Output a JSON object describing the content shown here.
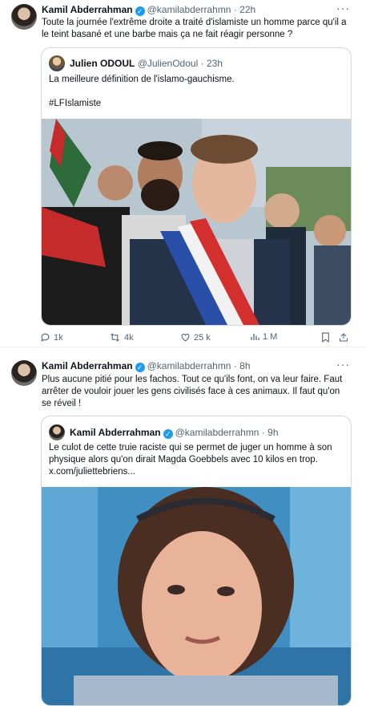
{
  "tweets": [
    {
      "author": "Kamil Abderrahman",
      "handle": "@kamilabderrahmn",
      "time": "· 22h",
      "text": "Toute la journée l'extrême droite a traité d'islamiste un homme parce qu'il a le teint basané et une barbe mais ça ne fait réagir personne ?",
      "quote": {
        "author": "Julien ODOUL",
        "handle": "@JulienOdoul",
        "time": "· 23h",
        "text": "La meilleure définition de l'islamo-gauchisme.\n\n#LFIslamiste"
      },
      "stats": {
        "replies": "1k",
        "retweets": "4k",
        "likes": "25 k",
        "views": "1 M"
      }
    },
    {
      "author": "Kamil Abderrahman",
      "handle": "@kamilabderrahmn",
      "time": "· 8h",
      "text": "Plus aucune pitié pour les fachos. Tout ce qu'ils font, on va leur faire. Faut arrêter de vouloir jouer les gens civilisés face à ces animaux. Il faut qu'on se réveil !",
      "quote": {
        "author": "Kamil Abderrahman",
        "handle": "@kamilabderrahmn",
        "time": "· 9h",
        "text": "Le culot de cette truie raciste qui se permet de juger un homme à son physique alors qu'on dirait Magda Goebbels avec 10 kilos en trop. x.com/juliettebriens..."
      }
    }
  ],
  "colors": {
    "accent": "#1d9bf0",
    "muted": "#536471",
    "border": "#cfd9de"
  },
  "icons": [
    "reply-icon",
    "retweet-icon",
    "like-icon",
    "views-icon",
    "bookmark-icon",
    "share-icon",
    "verified-icon",
    "more-icon"
  ]
}
